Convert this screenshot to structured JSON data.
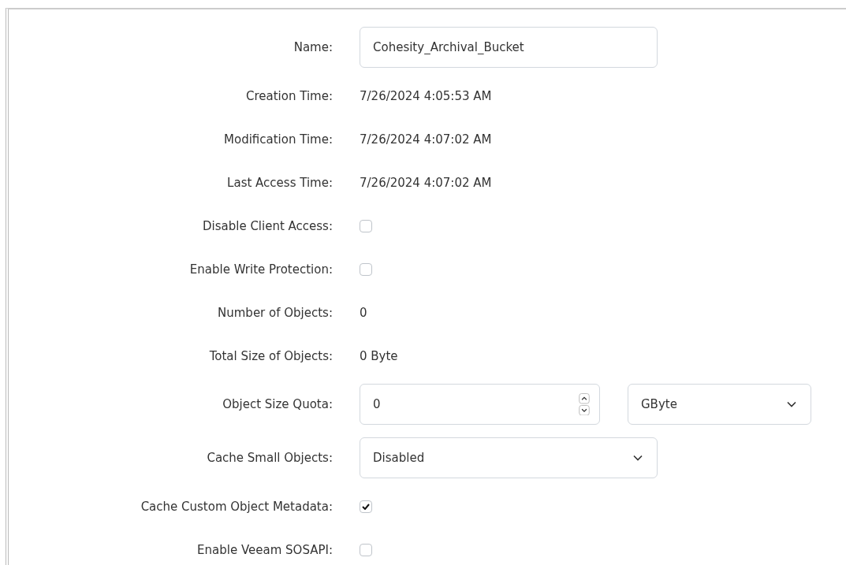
{
  "fields": [
    {
      "kind": "input",
      "label": "Name:",
      "value": "Cohesity_Archival_Bucket"
    },
    {
      "kind": "text",
      "label": "Creation Time:",
      "value": "7/26/2024 4:05:53 AM"
    },
    {
      "kind": "text",
      "label": "Modification Time:",
      "value": "7/26/2024 4:07:02 AM"
    },
    {
      "kind": "text",
      "label": "Last Access Time:",
      "value": "7/26/2024 4:07:02 AM"
    },
    {
      "kind": "checkbox",
      "label": "Disable Client Access:",
      "checked": false
    },
    {
      "kind": "checkbox",
      "label": "Enable Write Protection:",
      "checked": false
    },
    {
      "kind": "text",
      "label": "Number of Objects:",
      "value": "0"
    },
    {
      "kind": "text",
      "label": "Total Size of Objects:",
      "value": "0 Byte"
    },
    {
      "kind": "quota",
      "label": "Object Size Quota:",
      "value": "0",
      "unit": "GByte"
    },
    {
      "kind": "select",
      "label": "Cache Small Objects:",
      "value": "Disabled"
    },
    {
      "kind": "checkbox",
      "label": "Cache Custom Object Metadata:",
      "checked": true
    },
    {
      "kind": "checkbox",
      "label": "Enable Veeam SOSAPI:",
      "checked": false
    }
  ]
}
